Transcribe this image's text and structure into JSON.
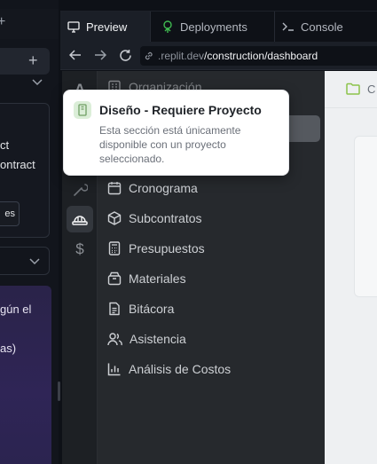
{
  "left_panel": {
    "card_line1": "ct",
    "card_line2": "ontract",
    "card_button": "es",
    "purple_line1": "gún el",
    "purple_line2": "as)"
  },
  "tabs": [
    {
      "label": "Preview",
      "icon": "preview-icon",
      "active": true
    },
    {
      "label": "Deployments",
      "icon": "deployments-icon",
      "active": false
    },
    {
      "label": "Console",
      "icon": "console-icon",
      "active": false
    }
  ],
  "address": {
    "host": ".replit.dev",
    "path": "/construction/dashboard"
  },
  "rail_icons": [
    {
      "name": "text-icon",
      "glyph": "A",
      "active": false
    },
    {
      "name": "wrench-icon",
      "glyph": "wrench",
      "active": false
    },
    {
      "name": "construction-helmet-icon",
      "glyph": "helmet",
      "active": true
    },
    {
      "name": "dollar-icon",
      "glyph": "$",
      "active": false
    }
  ],
  "menu": {
    "top_item": "Organización",
    "items": [
      {
        "label": "Cronograma",
        "icon": "calendar-icon"
      },
      {
        "label": "Subcontratos",
        "icon": "package-icon"
      },
      {
        "label": "Presupuestos",
        "icon": "calculator-icon"
      },
      {
        "label": "Materiales",
        "icon": "box-icon"
      },
      {
        "label": "Bitácora",
        "icon": "document-icon"
      },
      {
        "label": "Asistencia",
        "icon": "users-icon"
      },
      {
        "label": "Análisis de Costos",
        "icon": "bar-chart-icon"
      }
    ]
  },
  "content": {
    "breadcrumb": "C"
  },
  "tooltip": {
    "title": "Diseño - Requiere Proyecto",
    "body": "Esta sección está únicamente disponible con un proyecto seleccionado."
  },
  "colors": {
    "accent_green": "#8bc34a",
    "tooltip_icon_bg": "#dbeed8",
    "menu_selected": "#55595f"
  }
}
